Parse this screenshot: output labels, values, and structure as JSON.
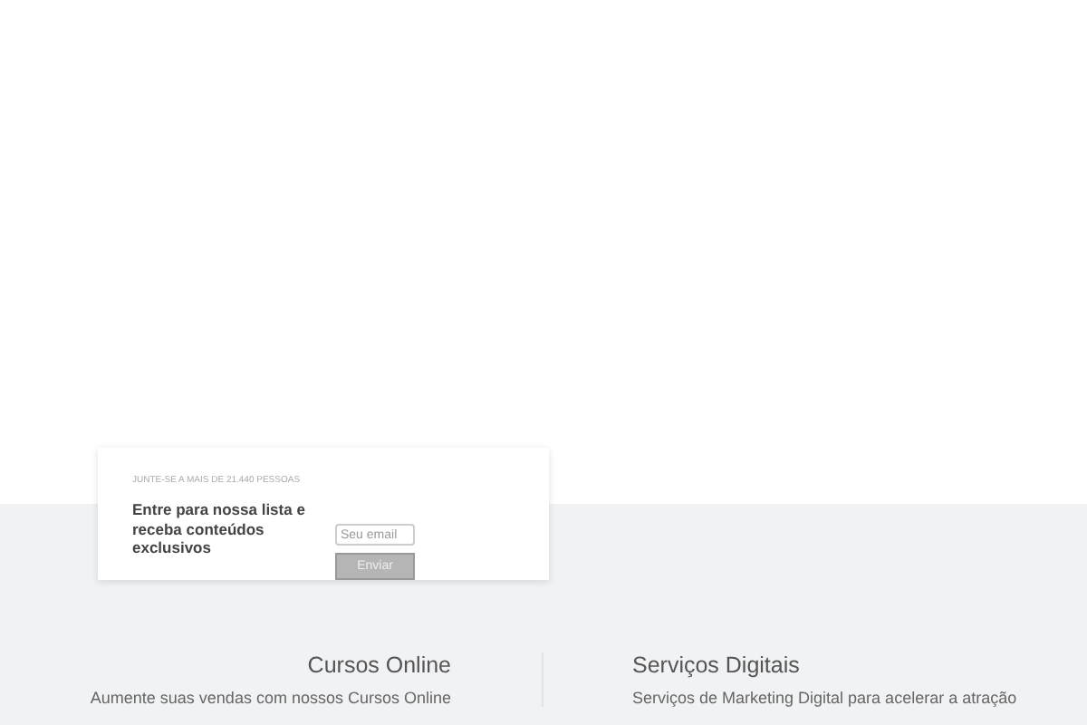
{
  "signup": {
    "eyebrow": "JUNTE-SE A MAIS DE 21.440 PESSOAS",
    "heading": "Entre para nossa lista e receba conteúdos exclusivos",
    "email": {
      "placeholder": "Seu email"
    },
    "button": "Enviar"
  },
  "features": [
    {
      "title": "Cursos Online",
      "text": "Aumente suas vendas com nossos Cursos Online"
    },
    {
      "title": "Serviços Digitais",
      "text": "Serviços de Marketing Digital para acelerar a atração"
    }
  ]
}
